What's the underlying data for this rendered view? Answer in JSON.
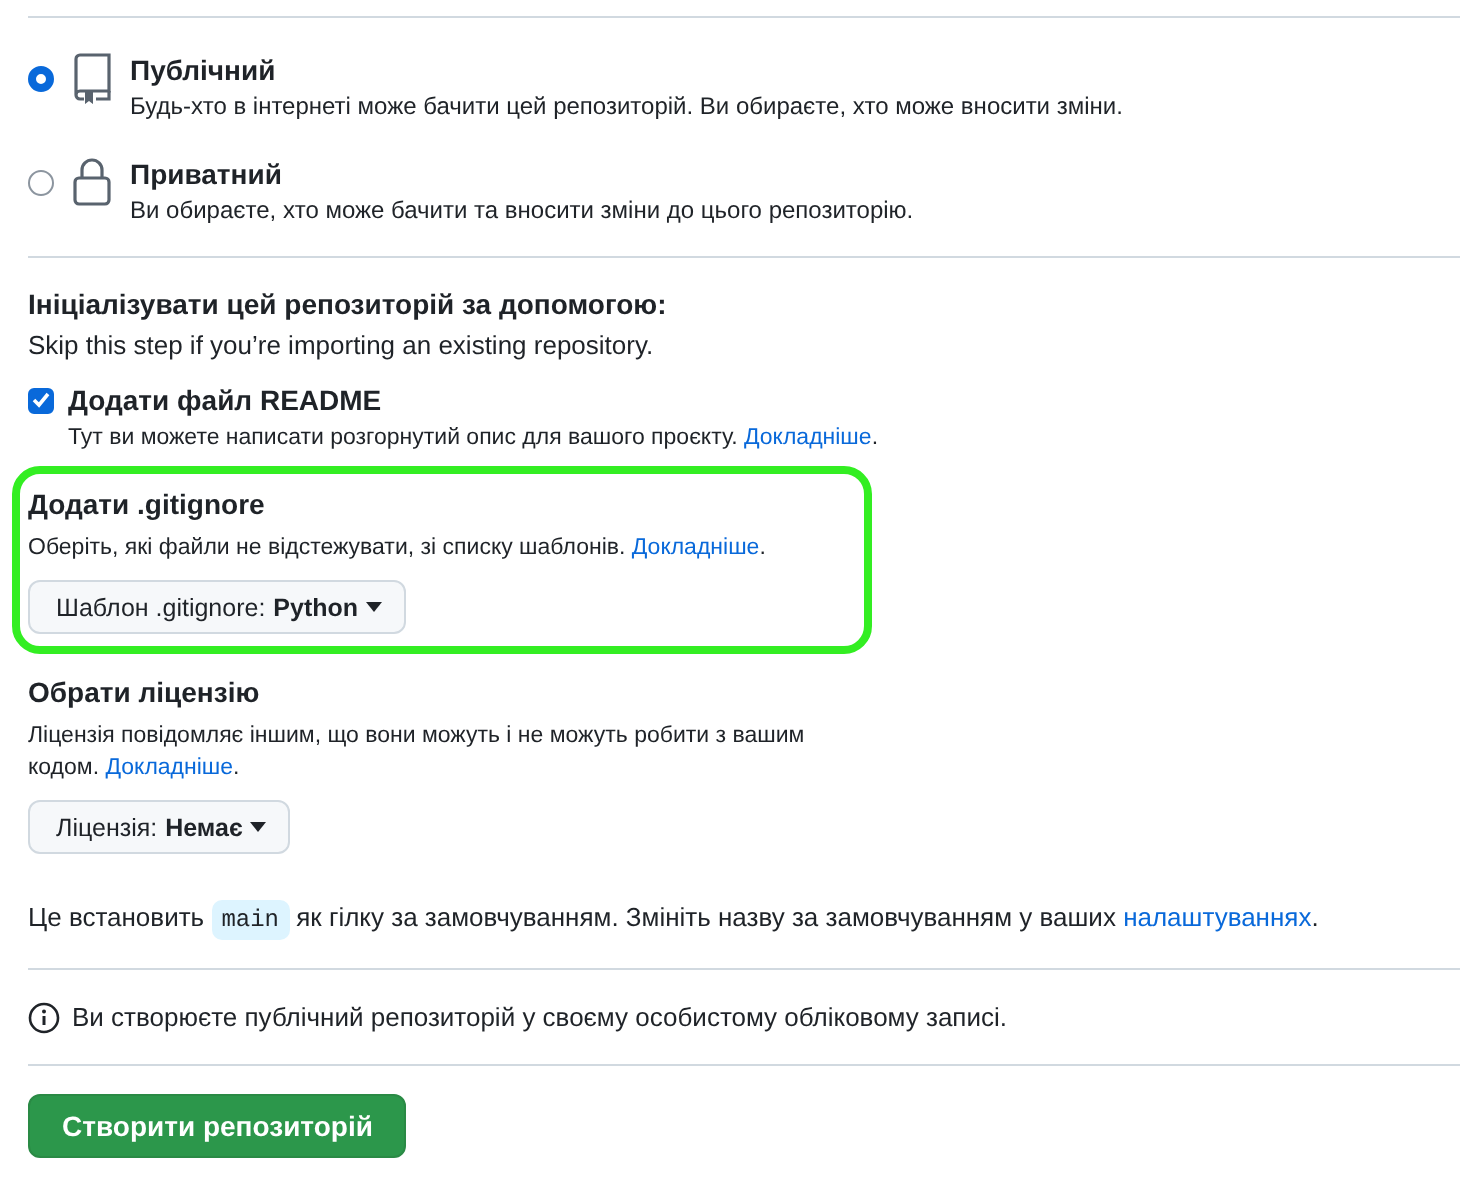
{
  "visibility_options": [
    {
      "kind": "public",
      "title": "Публічний",
      "description": "Будь-хто в інтернеті може бачити цей репозиторій. Ви обираєте, хто може вносити зміни.",
      "selected": true
    },
    {
      "kind": "private",
      "title": "Приватний",
      "description": "Ви обираєте, хто може бачити та вносити зміни до цього репозиторію.",
      "selected": false
    }
  ],
  "initialize": {
    "heading": "Ініціалізувати цей репозиторій за допомогою:",
    "subheading": "Skip this step if you’re importing an existing repository."
  },
  "readme": {
    "label": "Додати файл README",
    "checked": true,
    "description": "Тут ви можете написати розгорнутий опис для вашого проєкту.",
    "link": "Докладніше",
    "after": "."
  },
  "gitignore": {
    "heading": "Додати .gitignore",
    "description": "Оберіть, які файли не відстежувати, зі списку шаблонів.",
    "link": "Докладніше",
    "after": ".",
    "highlighted": true,
    "dropdown": {
      "label": "Шаблон .gitignore:",
      "value": "Python"
    }
  },
  "license": {
    "heading": "Обрати ліцензію",
    "description": "Ліцензія повідомляє іншим, що вони можуть і не можуть робити з вашим кодом.",
    "link": "Докладніше",
    "after": ".",
    "highlighted": false,
    "dropdown": {
      "label": "Ліцензія:",
      "value": "Немає"
    }
  },
  "branch_note": {
    "before": "Це встановить",
    "branch": "main",
    "after": "як гілку за замовчуванням. Змініть назву за замовчуванням у ваших",
    "link": "налаштуваннях",
    "end": "."
  },
  "info_note": "Ви створюєте публічний репозиторій у своєму особистому обліковому записі.",
  "create_button": "Створити репозиторій"
}
